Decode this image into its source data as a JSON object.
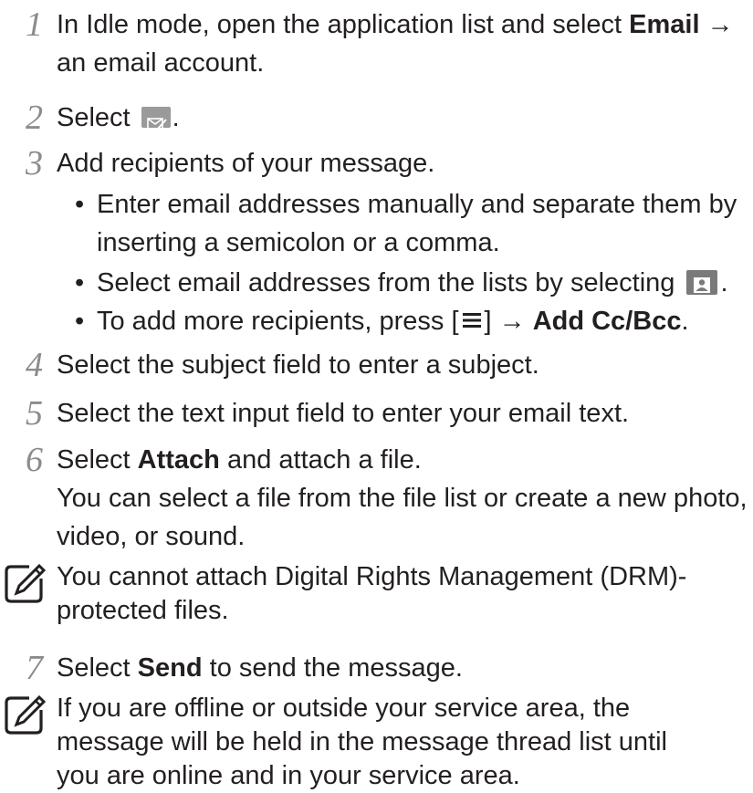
{
  "steps": [
    {
      "num": "1",
      "pre": "In Idle mode, open the application list and select ",
      "bold": "Email",
      "post": " →",
      "line2": "an email account."
    },
    {
      "num": "2",
      "pre": "Select ",
      "post": "."
    },
    {
      "num": "3",
      "text": "Add recipients of your message."
    },
    {
      "num": "4",
      "text": "Select the subject field to enter a subject."
    },
    {
      "num": "5",
      "text": "Select the text input field to enter your email text."
    },
    {
      "num": "6",
      "pre": "Select ",
      "bold": "Attach",
      "post": " and attach a file.",
      "line2": "You can select a file from the file list or create a new photo,",
      "line3": "video, or sound."
    },
    {
      "num": "7",
      "pre": "Select ",
      "bold": "Send",
      "post": " to send the message."
    }
  ],
  "bullets": [
    {
      "line1": "Enter email addresses manually and separate them by",
      "line2": "inserting a semicolon or a comma."
    },
    {
      "pre": "Select email addresses from the lists by selecting ",
      "post": "."
    },
    {
      "pre": "To add more recipients, press [",
      "mid": "] → ",
      "bold": "Add Cc/Bcc",
      "post": "."
    }
  ],
  "bullet_char": "•",
  "notes": [
    {
      "line1": "You cannot attach Digital Rights Management (DRM)-",
      "line2": "protected files."
    },
    {
      "line1": "If you are offline or outside your service area, the",
      "line2": "message will be held in the message thread list until",
      "line3": "you are online and in your service area."
    }
  ],
  "icons": {
    "step_number_color": "#8c8c8c",
    "note_icon": "note-pencil-icon",
    "email_icon": "compose-email-icon",
    "contact_icon": "contact-icon",
    "menu_icon": "menu-key-icon"
  }
}
